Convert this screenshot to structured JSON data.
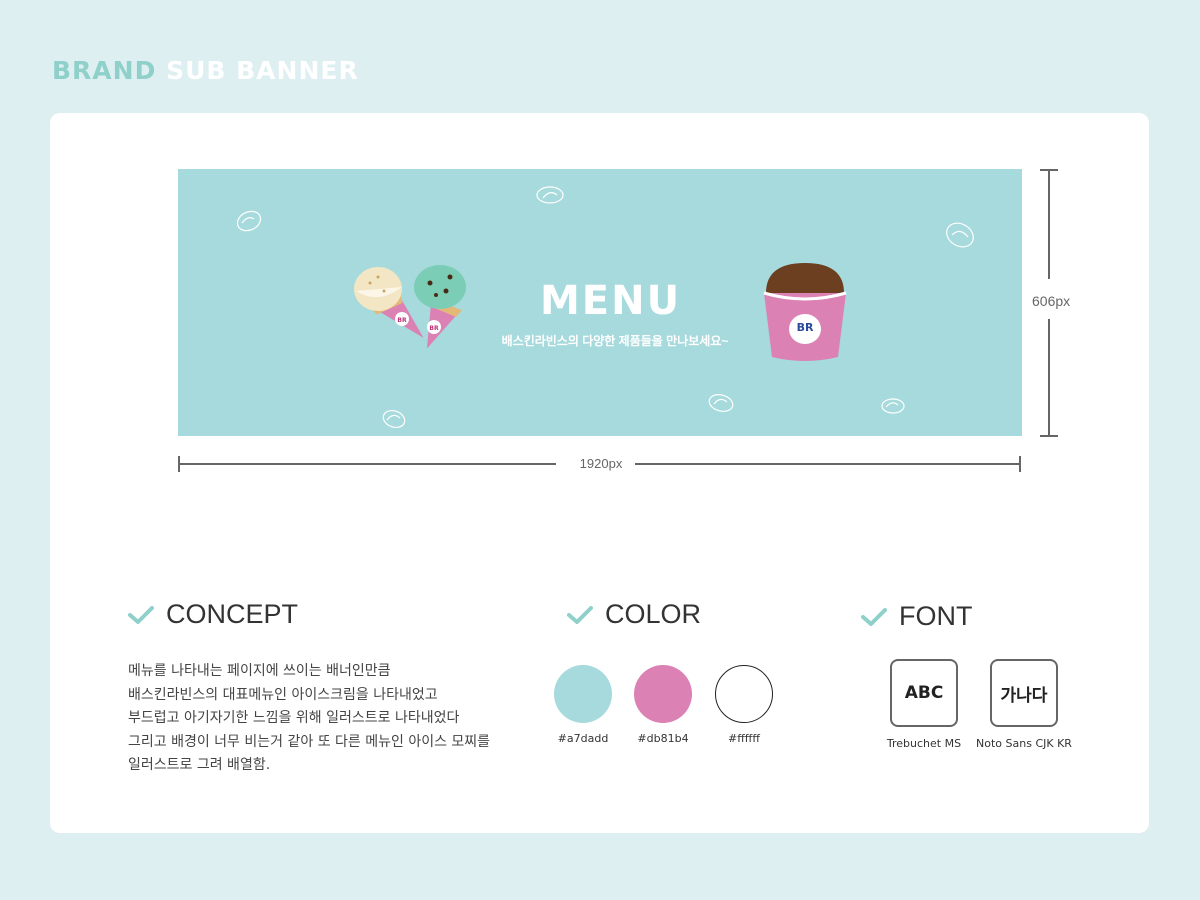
{
  "page": {
    "heading_part1": "BRAND",
    "heading_part2": "SUB BANNER"
  },
  "banner": {
    "title": "MENU",
    "subtitle": "배스킨라빈스의 다양한 제품들을 만나보세요~",
    "logo_text": "BR"
  },
  "dimensions": {
    "width_label": "1920px",
    "height_label": "606px"
  },
  "concept": {
    "title": "CONCEPT",
    "lines": [
      "메뉴를 나타내는 페이지에 쓰이는 배너인만큼",
      "배스킨라빈스의 대표메뉴인 아이스크림을 나타내었고",
      "부드럽고 아기자기한 느낌을 위해 일러스트로 나타내었다",
      "그리고 배경이 너무 비는거 같아 또 다른 메뉴인 아이스 모찌를",
      "일러스트로 그려 배열함."
    ]
  },
  "color": {
    "title": "COLOR",
    "swatches": [
      {
        "hex": "#a7dadd",
        "label": "#a7dadd"
      },
      {
        "hex": "#db81b4",
        "label": "#db81b4"
      },
      {
        "hex": "#ffffff",
        "label": "#ffffff"
      }
    ]
  },
  "font": {
    "title": "FONT",
    "items": [
      {
        "sample": "ABC",
        "name": "Trebuchet MS"
      },
      {
        "sample": "가나다",
        "name": "Noto Sans CJK KR"
      }
    ]
  },
  "colors": {
    "accent": "#8fd0cb",
    "banner_bg": "#a7dadd",
    "pink": "#db81b4",
    "chocolate": "#6b3f1f"
  }
}
